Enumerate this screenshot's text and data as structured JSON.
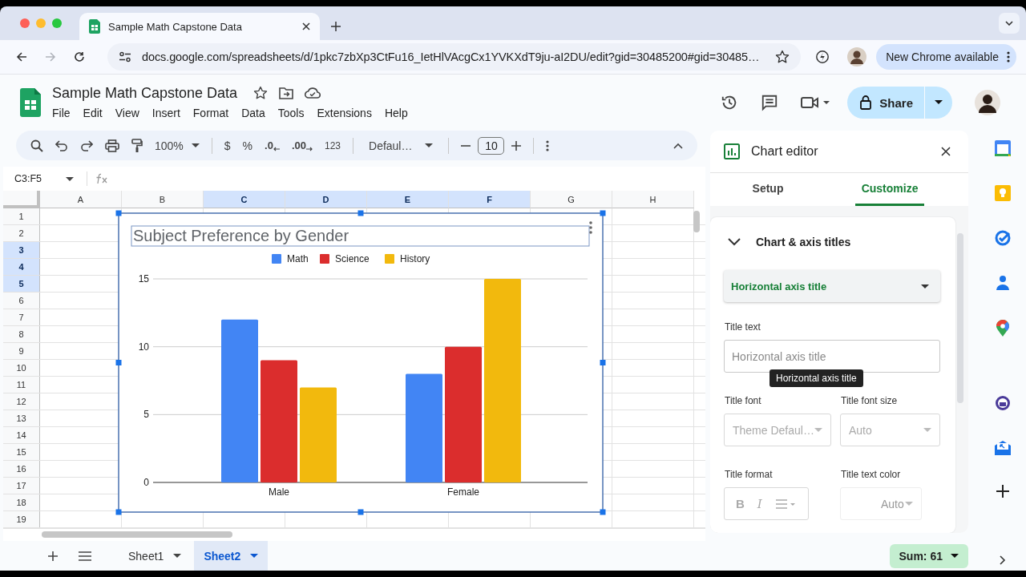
{
  "browser": {
    "tabs": [
      {
        "title": "Sample Math Capstone Data",
        "selected": true
      }
    ],
    "url": "docs.google.com/spreadsheets/d/1pkc7zbXp3CtFu16_IetHlVAcgCx1YVKXdT9ju-aI2DU/edit?gid=30485200#gid=30485…",
    "forward_disabled": true,
    "update_button": "New Chrome available"
  },
  "document": {
    "title": "Sample Math Capstone Data",
    "menu": [
      "File",
      "Edit",
      "View",
      "Insert",
      "Format",
      "Data",
      "Tools",
      "Extensions",
      "Help"
    ],
    "share_button": "Share"
  },
  "toolbar": {
    "zoom": "100%",
    "currency": "$",
    "percent": "%",
    "decrease_decimal": ".0",
    "increase_decimal": ".00",
    "number_format": "123",
    "font": "Defaul…",
    "font_size": "10"
  },
  "formula_bar": {
    "name_box": "C3:F5"
  },
  "grid": {
    "columns": [
      {
        "label": "A",
        "selected": false
      },
      {
        "label": "B",
        "selected": false
      },
      {
        "label": "C",
        "selected": true
      },
      {
        "label": "D",
        "selected": true
      },
      {
        "label": "E",
        "selected": true
      },
      {
        "label": "F",
        "selected": true
      },
      {
        "label": "G",
        "selected": false
      },
      {
        "label": "H",
        "selected": false
      }
    ],
    "rows": [
      {
        "label": "1",
        "selected": false
      },
      {
        "label": "2",
        "selected": false
      },
      {
        "label": "3",
        "selected": true
      },
      {
        "label": "4",
        "selected": true
      },
      {
        "label": "5",
        "selected": true
      },
      {
        "label": "6",
        "selected": false
      },
      {
        "label": "7",
        "selected": false
      },
      {
        "label": "8",
        "selected": false
      },
      {
        "label": "9",
        "selected": false
      },
      {
        "label": "10",
        "selected": false
      },
      {
        "label": "11",
        "selected": false
      },
      {
        "label": "12",
        "selected": false
      },
      {
        "label": "13",
        "selected": false
      },
      {
        "label": "14",
        "selected": false
      },
      {
        "label": "15",
        "selected": false
      },
      {
        "label": "16",
        "selected": false
      },
      {
        "label": "17",
        "selected": false
      },
      {
        "label": "18",
        "selected": false
      },
      {
        "label": "19",
        "selected": false
      }
    ]
  },
  "chart": {
    "chart_data": {
      "type": "bar",
      "title": "Subject Preference by Gender",
      "categories": [
        "Male",
        "Female"
      ],
      "series": [
        {
          "name": "Math",
          "color": "#4285f4",
          "values": [
            12,
            8
          ]
        },
        {
          "name": "Science",
          "color": "#db2d2d",
          "values": [
            9,
            10
          ]
        },
        {
          "name": "History",
          "color": "#f2b90d",
          "values": [
            7,
            15
          ]
        }
      ],
      "ylim": [
        0,
        15
      ],
      "yticks": [
        0,
        5,
        10,
        15
      ],
      "legend": "top"
    }
  },
  "chart_editor": {
    "title": "Chart editor",
    "tabs": [
      {
        "label": "Setup",
        "selected": false
      },
      {
        "label": "Customize",
        "selected": true
      }
    ],
    "section": {
      "title": "Chart & axis titles",
      "expanded": true
    },
    "target": "Horizontal axis title",
    "title_text": {
      "label": "Title text",
      "placeholder": "Horizontal axis title"
    },
    "tooltip": "Horizontal axis title",
    "title_font": {
      "label": "Title font",
      "value": "Theme Defaul…",
      "disabled": true
    },
    "title_font_size": {
      "label": "Title font size",
      "value": "Auto",
      "disabled": true
    },
    "title_format": {
      "label": "Title format",
      "bold": "B",
      "italic": "I",
      "disabled": true
    },
    "title_text_color": {
      "label": "Title text color",
      "value": "Auto",
      "disabled": true
    }
  },
  "sheet_tabs": [
    {
      "label": "Sheet1",
      "selected": false
    },
    {
      "label": "Sheet2",
      "selected": true
    }
  ],
  "sum": "Sum: 61"
}
